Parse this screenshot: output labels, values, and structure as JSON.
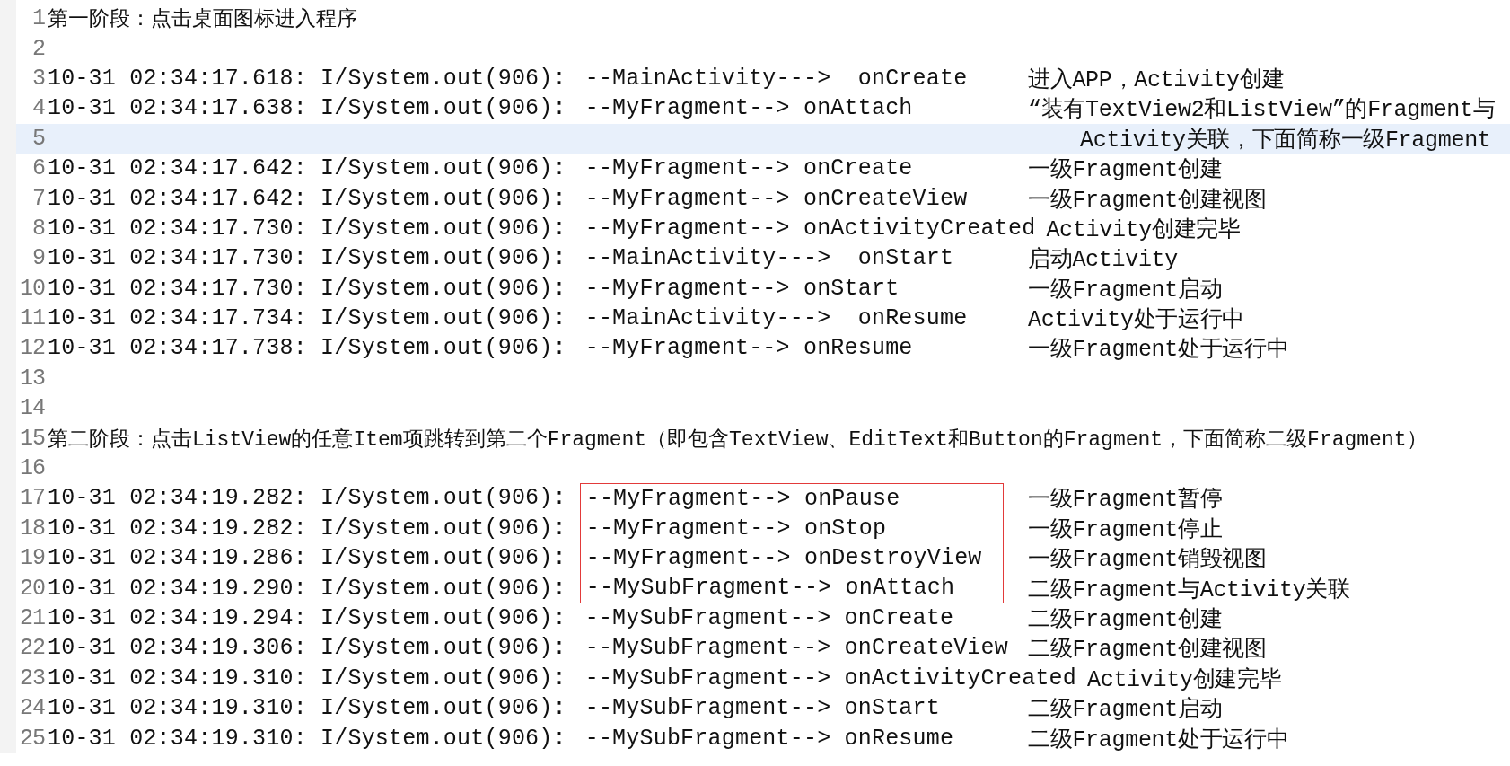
{
  "lines": [
    {
      "number": "1",
      "kind": "heading",
      "text": "第一阶段：点击桌面图标进入程序",
      "current": false
    },
    {
      "number": "2",
      "kind": "empty",
      "current": false
    },
    {
      "number": "3",
      "kind": "log",
      "prefix": "10-31 02:34:17.618: I/System.out(906):",
      "message": "--MainActivity--->  onCreate",
      "comment": "进入APP，Activity创建",
      "boxed": false,
      "current": false
    },
    {
      "number": "4",
      "kind": "log",
      "prefix": "10-31 02:34:17.638: I/System.out(906):",
      "message": "--MyFragment--> onAttach",
      "comment": "“装有TextView2和ListView”的Fragment与",
      "boxed": false,
      "current": false
    },
    {
      "number": "5",
      "kind": "note",
      "comment": "Activity关联，下面简称一级Fragment",
      "current": true
    },
    {
      "number": "6",
      "kind": "log",
      "prefix": "10-31 02:34:17.642: I/System.out(906):",
      "message": "--MyFragment--> onCreate",
      "comment": "一级Fragment创建",
      "boxed": false,
      "current": false
    },
    {
      "number": "7",
      "kind": "log",
      "prefix": "10-31 02:34:17.642: I/System.out(906):",
      "message": "--MyFragment--> onCreateView",
      "comment": "一级Fragment创建视图",
      "boxed": false,
      "current": false
    },
    {
      "number": "8",
      "kind": "log",
      "prefix": "10-31 02:34:17.730: I/System.out(906):",
      "message": "--MyFragment--> onActivityCreated",
      "comment": "Activity创建完毕",
      "boxed": false,
      "current": false
    },
    {
      "number": "9",
      "kind": "log",
      "prefix": "10-31 02:34:17.730: I/System.out(906):",
      "message": "--MainActivity--->  onStart",
      "comment": "启动Activity",
      "boxed": false,
      "current": false
    },
    {
      "number": "10",
      "kind": "log",
      "prefix": "10-31 02:34:17.730: I/System.out(906):",
      "message": "--MyFragment--> onStart",
      "comment": "一级Fragment启动",
      "boxed": false,
      "current": false
    },
    {
      "number": "11",
      "kind": "log",
      "prefix": "10-31 02:34:17.734: I/System.out(906):",
      "message": "--MainActivity--->  onResume",
      "comment": "Activity处于运行中",
      "boxed": false,
      "current": false
    },
    {
      "number": "12",
      "kind": "log",
      "prefix": "10-31 02:34:17.738: I/System.out(906):",
      "message": "--MyFragment--> onResume",
      "comment": "一级Fragment处于运行中",
      "boxed": false,
      "current": false
    },
    {
      "number": "13",
      "kind": "empty",
      "current": false
    },
    {
      "number": "14",
      "kind": "empty",
      "current": false
    },
    {
      "number": "15",
      "kind": "heading",
      "text": "第二阶段：点击ListView的任意Item项跳转到第二个Fragment（即包含TextView、EditText和Button的Fragment，下面简称二级Fragment）",
      "current": false
    },
    {
      "number": "16",
      "kind": "empty",
      "current": false
    },
    {
      "number": "17",
      "kind": "log",
      "prefix": "10-31 02:34:19.282: I/System.out(906):",
      "message": "--MyFragment--> onPause",
      "comment": "一级Fragment暂停",
      "boxed": true,
      "current": false
    },
    {
      "number": "18",
      "kind": "log",
      "prefix": "10-31 02:34:19.282: I/System.out(906):",
      "message": "--MyFragment--> onStop",
      "comment": "一级Fragment停止",
      "boxed": true,
      "current": false
    },
    {
      "number": "19",
      "kind": "log",
      "prefix": "10-31 02:34:19.286: I/System.out(906):",
      "message": "--MyFragment--> onDestroyView",
      "comment": "一级Fragment销毁视图",
      "boxed": true,
      "current": false
    },
    {
      "number": "20",
      "kind": "log",
      "prefix": "10-31 02:34:19.290: I/System.out(906):",
      "message": "--MySubFragment--> onAttach",
      "comment": "二级Fragment与Activity关联",
      "boxed": true,
      "current": false
    },
    {
      "number": "21",
      "kind": "log",
      "prefix": "10-31 02:34:19.294: I/System.out(906):",
      "message": "--MySubFragment--> onCreate",
      "comment": "二级Fragment创建",
      "boxed": false,
      "current": false
    },
    {
      "number": "22",
      "kind": "log",
      "prefix": "10-31 02:34:19.306: I/System.out(906):",
      "message": "--MySubFragment--> onCreateView",
      "comment": "二级Fragment创建视图",
      "boxed": false,
      "current": false
    },
    {
      "number": "23",
      "kind": "log",
      "prefix": "10-31 02:34:19.310: I/System.out(906):",
      "message": "--MySubFragment--> onActivityCreated",
      "comment": "Activity创建完毕",
      "boxed": false,
      "current": false
    },
    {
      "number": "24",
      "kind": "log",
      "prefix": "10-31 02:34:19.310: I/System.out(906):",
      "message": "--MySubFragment--> onStart",
      "comment": "二级Fragment启动",
      "boxed": false,
      "current": false
    },
    {
      "number": "25",
      "kind": "log",
      "prefix": "10-31 02:34:19.310: I/System.out(906):",
      "message": "--MySubFragment--> onResume",
      "comment": "二级Fragment处于运行中",
      "boxed": false,
      "current": false
    }
  ]
}
